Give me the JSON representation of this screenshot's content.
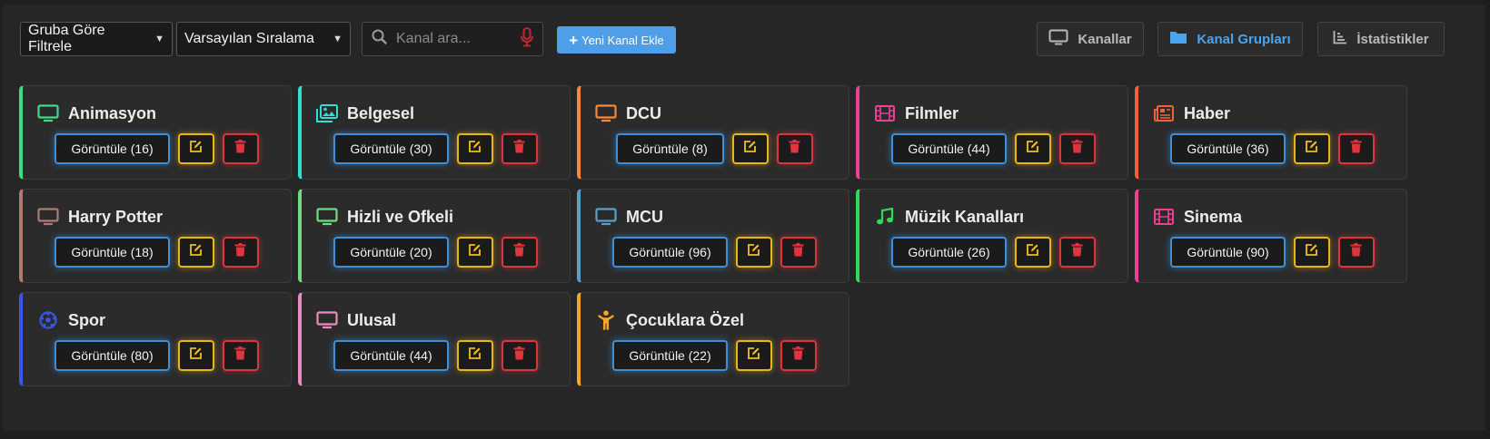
{
  "toolbar": {
    "group_filter": "Gruba Göre Filtrele",
    "sort": "Varsayılan Sıralama",
    "search_placeholder": "Kanal ara...",
    "add_label": "Yeni Kanal Ekle",
    "nav": [
      {
        "label": "Kanallar",
        "icon": "tv-icon",
        "active": false
      },
      {
        "label": "Kanal Grupları",
        "icon": "folder-icon",
        "active": true
      },
      {
        "label": "İstatistikler",
        "icon": "chart-icon",
        "active": false
      }
    ]
  },
  "groups": [
    {
      "name": "Animasyon",
      "icon": "tv-icon",
      "color": "#3ddc84",
      "view": "Görüntüle (16)"
    },
    {
      "name": "Belgesel",
      "icon": "photo-icon",
      "color": "#2de0d0",
      "view": "Görüntüle (30)"
    },
    {
      "name": "DCU",
      "icon": "tv-icon",
      "color": "#f5883b",
      "view": "Görüntüle (8)"
    },
    {
      "name": "Filmler",
      "icon": "film-icon",
      "color": "#ec3f95",
      "view": "Görüntüle (44)"
    },
    {
      "name": "Haber",
      "icon": "newspaper-icon",
      "color": "#f0623a",
      "view": "Görüntüle (36)"
    },
    {
      "name": "Harry Potter",
      "icon": "tv-icon",
      "color": "#b07a72",
      "view": "Görüntüle (18)"
    },
    {
      "name": "Hizli ve Ofkeli",
      "icon": "tv-icon",
      "color": "#6edb83",
      "view": "Görüntüle (20)"
    },
    {
      "name": "MCU",
      "icon": "tv-icon",
      "color": "#5aa0c4",
      "view": "Görüntüle (96)"
    },
    {
      "name": "Müzik Kanalları",
      "icon": "music-icon",
      "color": "#31d95a",
      "view": "Görüntüle (26)"
    },
    {
      "name": "Sinema",
      "icon": "film-icon",
      "color": "#ec3f95",
      "view": "Görüntüle (90)"
    },
    {
      "name": "Spor",
      "icon": "soccer-icon",
      "color": "#3b55e6",
      "view": "Görüntüle (80)"
    },
    {
      "name": "Ulusal",
      "icon": "tv-icon",
      "color": "#e88cc0",
      "view": "Görüntüle (44)"
    },
    {
      "name": "Çocuklara Özel",
      "icon": "child-icon",
      "color": "#f5a623",
      "view": "Görüntüle (22)"
    }
  ]
}
